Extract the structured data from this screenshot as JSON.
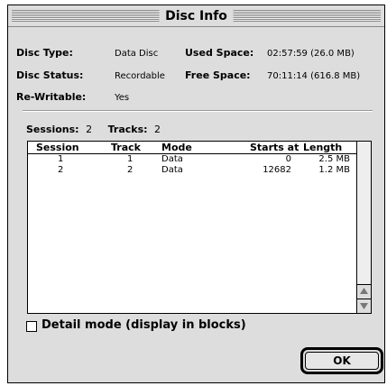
{
  "window": {
    "title": "Disc Info"
  },
  "info": {
    "disc_type_label": "Disc Type:",
    "disc_type_value": "Data Disc",
    "disc_status_label": "Disc Status:",
    "disc_status_value": "Recordable",
    "rewritable_label": "Re-Writable:",
    "rewritable_value": "Yes",
    "used_space_label": "Used Space:",
    "used_space_value": "02:57:59 (26.0 MB)",
    "free_space_label": "Free Space:",
    "free_space_value": "70:11:14 (616.8 MB)"
  },
  "counts": {
    "sessions_label": "Sessions:",
    "sessions_value": "2",
    "tracks_label": "Tracks:",
    "tracks_value": "2"
  },
  "table": {
    "columns": [
      "Session",
      "Track",
      "Mode",
      "Starts at",
      "Length"
    ],
    "rows": [
      {
        "session": "1",
        "track": "1",
        "mode": "Data",
        "starts_at": "0",
        "length": "2.5 MB"
      },
      {
        "session": "2",
        "track": "2",
        "mode": "Data",
        "starts_at": "12682",
        "length": "1.2 MB"
      }
    ]
  },
  "detail_mode": {
    "label": "Detail mode (display in blocks)",
    "checked": false
  },
  "ok_button": {
    "label": "OK"
  },
  "icons": {
    "scroll_up": "up-arrow-icon",
    "scroll_down": "down-arrow-icon"
  }
}
